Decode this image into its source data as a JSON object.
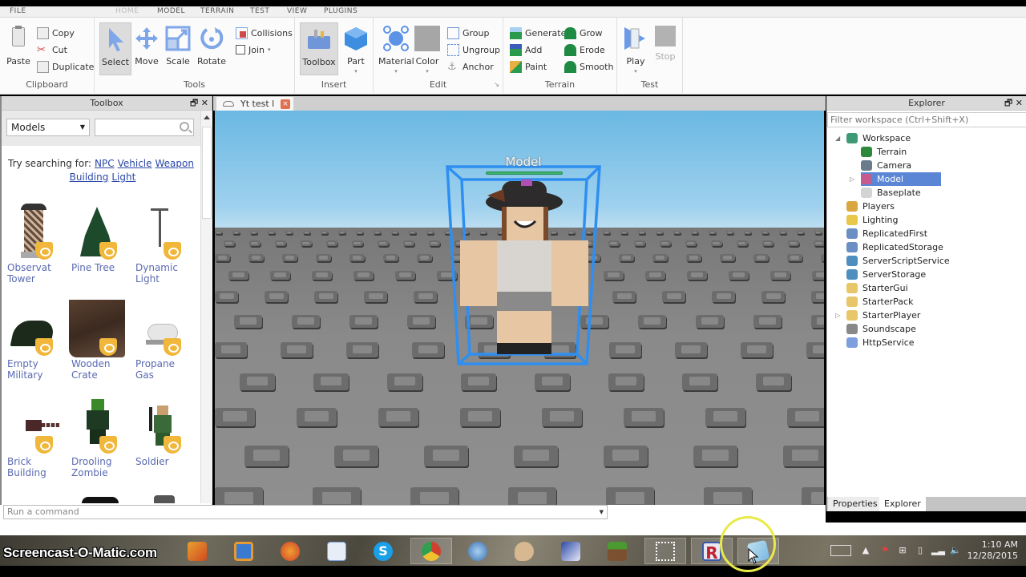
{
  "menu_tabs": [
    "FILE",
    "HOME",
    "MODEL",
    "TERRAIN",
    "TEST",
    "VIEW",
    "PLUGINS"
  ],
  "ribbon": {
    "clipboard": {
      "paste": "Paste",
      "copy": "Copy",
      "cut": "Cut",
      "duplicate": "Duplicate",
      "label": "Clipboard"
    },
    "tools": {
      "select": "Select",
      "move": "Move",
      "scale": "Scale",
      "rotate": "Rotate",
      "collisions": "Collisions",
      "join": "Join",
      "label": "Tools"
    },
    "insert": {
      "toolbox": "Toolbox",
      "part": "Part",
      "label": "Insert"
    },
    "edit": {
      "material": "Material",
      "color": "Color",
      "group": "Group",
      "ungroup": "Ungroup",
      "anchor": "Anchor",
      "label": "Edit"
    },
    "terrain": {
      "generate": "Generate",
      "add": "Add",
      "paint": "Paint",
      "grow": "Grow",
      "erode": "Erode",
      "smooth": "Smooth",
      "label": "Terrain"
    },
    "test": {
      "play": "Play",
      "stop": "Stop",
      "label": "Test"
    }
  },
  "toolbox": {
    "title": "Toolbox",
    "category": "Models",
    "search_placeholder": "",
    "try_text": "Try searching for:",
    "suggestions": [
      "NPC",
      "Vehicle",
      "Weapon",
      "Building",
      "Light"
    ],
    "items": [
      {
        "line1": "Observat",
        "line2": "Tower"
      },
      {
        "line1": "Pine Tree",
        "line2": ""
      },
      {
        "line1": "Dynamic",
        "line2": "Light"
      },
      {
        "line1": "Empty",
        "line2": "Military"
      },
      {
        "line1": "Wooden",
        "line2": "Crate"
      },
      {
        "line1": "Propane",
        "line2": "Gas"
      },
      {
        "line1": "Brick",
        "line2": "Building"
      },
      {
        "line1": "Drooling",
        "line2": "Zombie"
      },
      {
        "line1": "Soldier",
        "line2": ""
      }
    ]
  },
  "document_tab": {
    "title": "Yt test l",
    "close": "×"
  },
  "viewport": {
    "model_label": "Model"
  },
  "command_bar": {
    "placeholder": "Run a command"
  },
  "explorer": {
    "title": "Explorer",
    "filter_placeholder": "Filter workspace (Ctrl+Shift+X)",
    "tree": [
      {
        "label": "Workspace",
        "color": "#3d9a74"
      },
      {
        "label": "Terrain",
        "color": "#2e8a3a"
      },
      {
        "label": "Camera",
        "color": "#6a7b8c"
      },
      {
        "label": "Model",
        "color": "#c75a8e"
      },
      {
        "label": "Baseplate",
        "color": "#d4d4d4"
      },
      {
        "label": "Players",
        "color": "#d9a640"
      },
      {
        "label": "Lighting",
        "color": "#e7c84a"
      },
      {
        "label": "ReplicatedFirst",
        "color": "#6b8fc4"
      },
      {
        "label": "ReplicatedStorage",
        "color": "#6b8fc4"
      },
      {
        "label": "ServerScriptService",
        "color": "#4f8fbf"
      },
      {
        "label": "ServerStorage",
        "color": "#4f8fbf"
      },
      {
        "label": "StarterGui",
        "color": "#e8c66a"
      },
      {
        "label": "StarterPack",
        "color": "#e8c66a"
      },
      {
        "label": "StarterPlayer",
        "color": "#e8c66a"
      },
      {
        "label": "Soundscape",
        "color": "#888888"
      },
      {
        "label": "HttpService",
        "color": "#7d9fde"
      }
    ],
    "tabs": [
      "Properties",
      "Explorer"
    ]
  },
  "taskbar": {
    "watermark": "Screencast-O-Matic.com",
    "time": "1:10 AM",
    "date": "12/28/2015"
  },
  "colors": {
    "selection_blue": "#2f8ff0",
    "selected_row": "#5b86d6",
    "link": "#2a47a8"
  }
}
